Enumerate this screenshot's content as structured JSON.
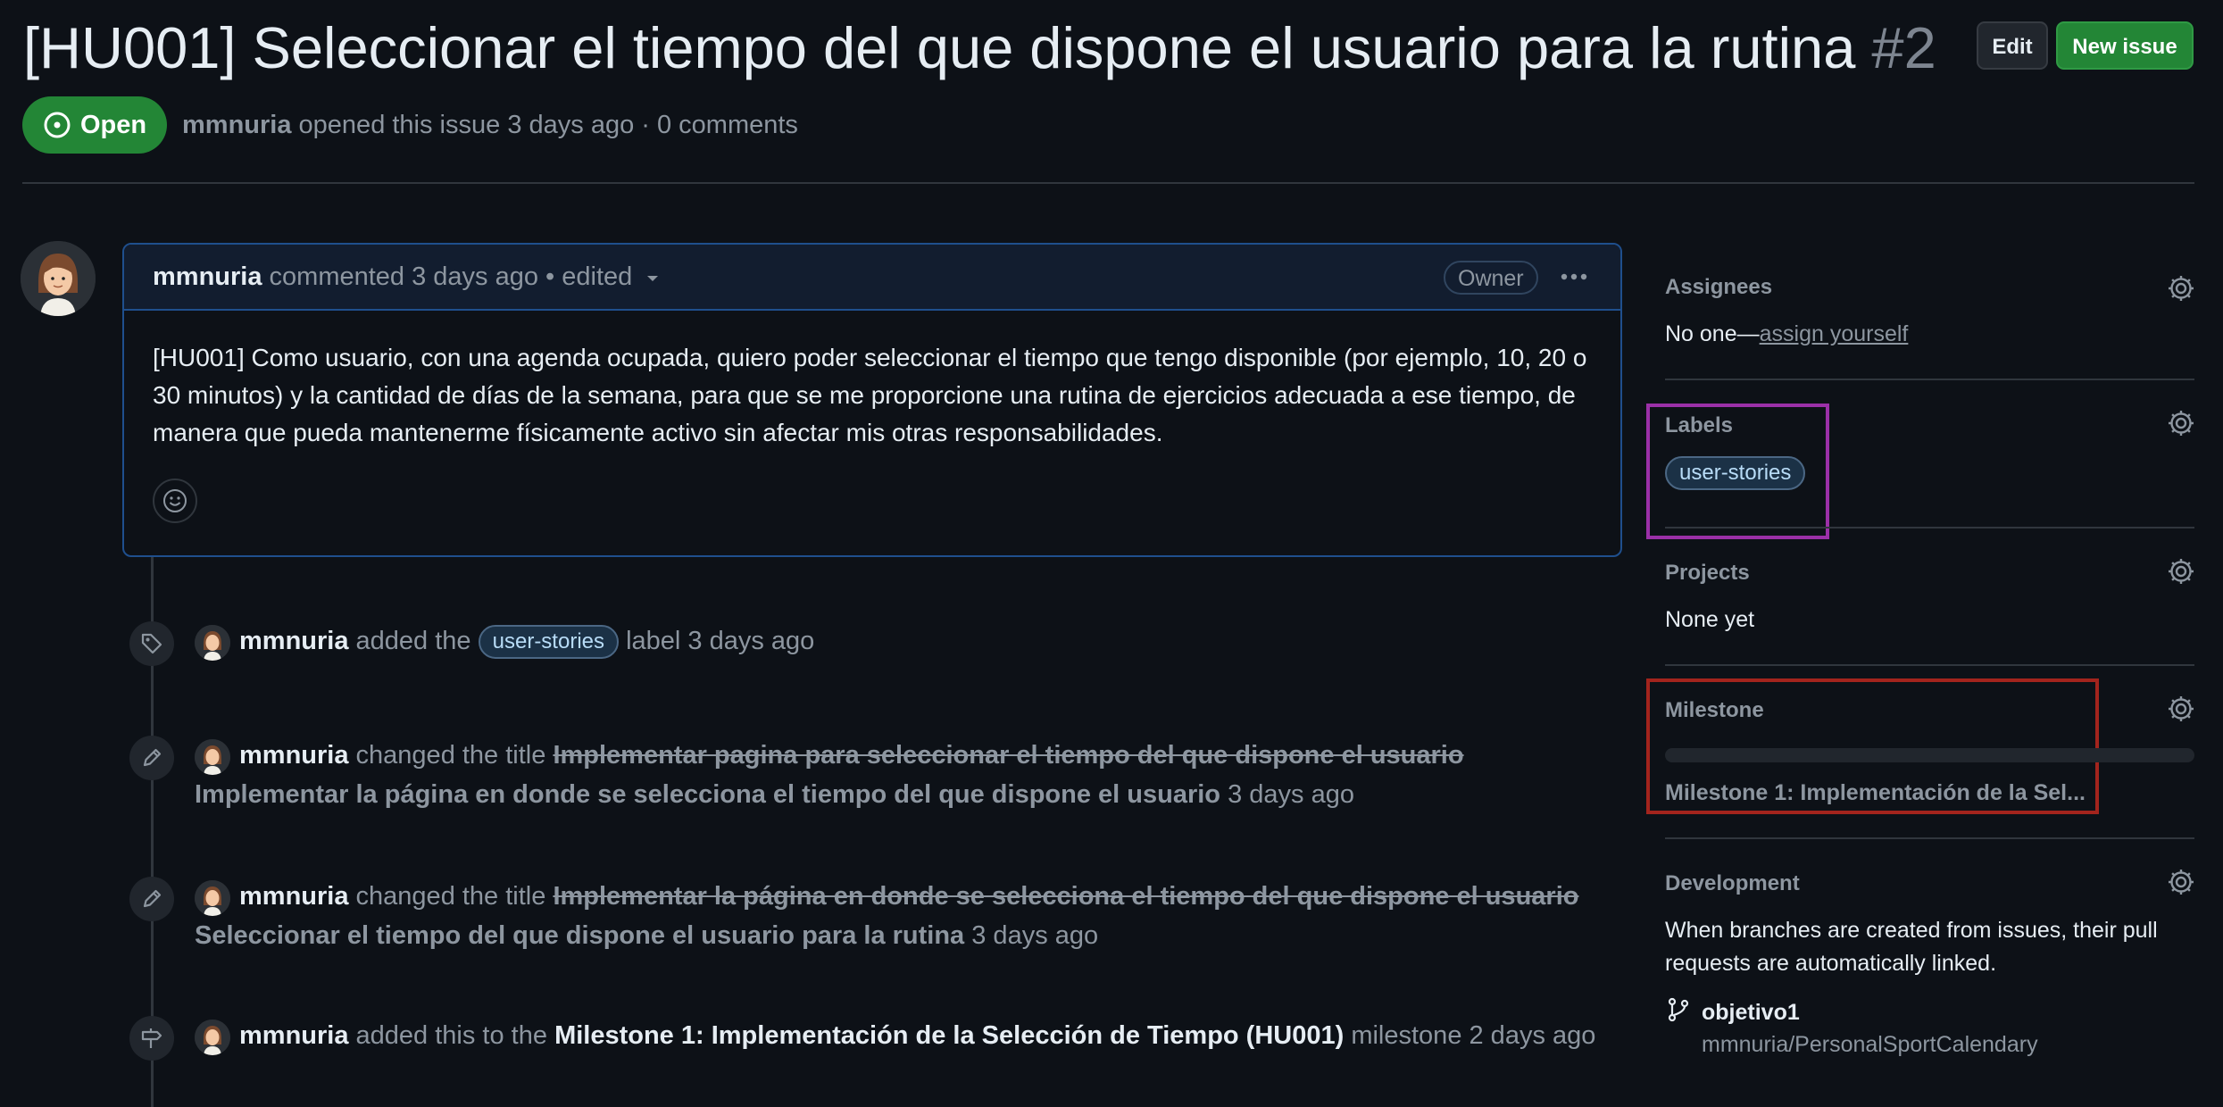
{
  "header": {
    "title": "[HU001] Seleccionar el tiempo del que dispone el usuario para la rutina",
    "number": "#2",
    "edit_label": "Edit",
    "new_issue_label": "New issue",
    "state": "Open",
    "author": "mmnuria",
    "meta": "opened this issue 3 days ago · 0 comments"
  },
  "comment": {
    "author": "mmnuria",
    "meta": "commented 3 days ago • edited",
    "badge": "Owner",
    "body": "[HU001] Como usuario, con una agenda ocupada, quiero poder seleccionar el tiempo que tengo disponible (por ejemplo, 10, 20 o 30 minutos) y la cantidad de días de la semana, para que se me proporcione una rutina de ejercicios adecuada a ese tiempo, de manera que pueda mantenerme físicamente activo sin afectar mis otras responsabilidades."
  },
  "timeline": [
    {
      "actor": "mmnuria",
      "pre": "added the",
      "label": "user-stories",
      "post": "label 3 days ago"
    },
    {
      "actor": "mmnuria",
      "pre": "changed the title",
      "old": "Implementar pagina para seleccionar el tiempo del que dispone el usuario",
      "new": "Implementar la página en donde se selecciona el tiempo del que dispone el usuario",
      "time": "3 days ago"
    },
    {
      "actor": "mmnuria",
      "pre": "changed the title",
      "old": "Implementar la página en donde se selecciona el tiempo del que dispone el usuario",
      "new": "Seleccionar el tiempo del que dispone el usuario para la rutina",
      "time": "3 days ago"
    },
    {
      "actor": "mmnuria",
      "pre": "added this to the",
      "milestone": "Milestone 1: Implementación de la Selección de Tiempo (HU001)",
      "post": "milestone 2 days ago"
    }
  ],
  "sidebar": {
    "assignees": {
      "title": "Assignees",
      "text": "No one—",
      "link": "assign yourself"
    },
    "labels": {
      "title": "Labels",
      "label": "user-stories"
    },
    "projects": {
      "title": "Projects",
      "text": "None yet"
    },
    "milestone": {
      "title": "Milestone",
      "name": "Milestone 1: Implementación de la Sel...",
      "progress": 0
    },
    "development": {
      "title": "Development",
      "text": "When branches are created from issues, their pull requests are automatically linked.",
      "branch": "objetivo1",
      "repo": "mmnuria/PersonalSportCalendary"
    }
  },
  "colors": {
    "background": "#0d1117",
    "open_green": "#238636",
    "labels_highlight": "#9b30a8",
    "milestone_highlight": "#a3241d"
  }
}
